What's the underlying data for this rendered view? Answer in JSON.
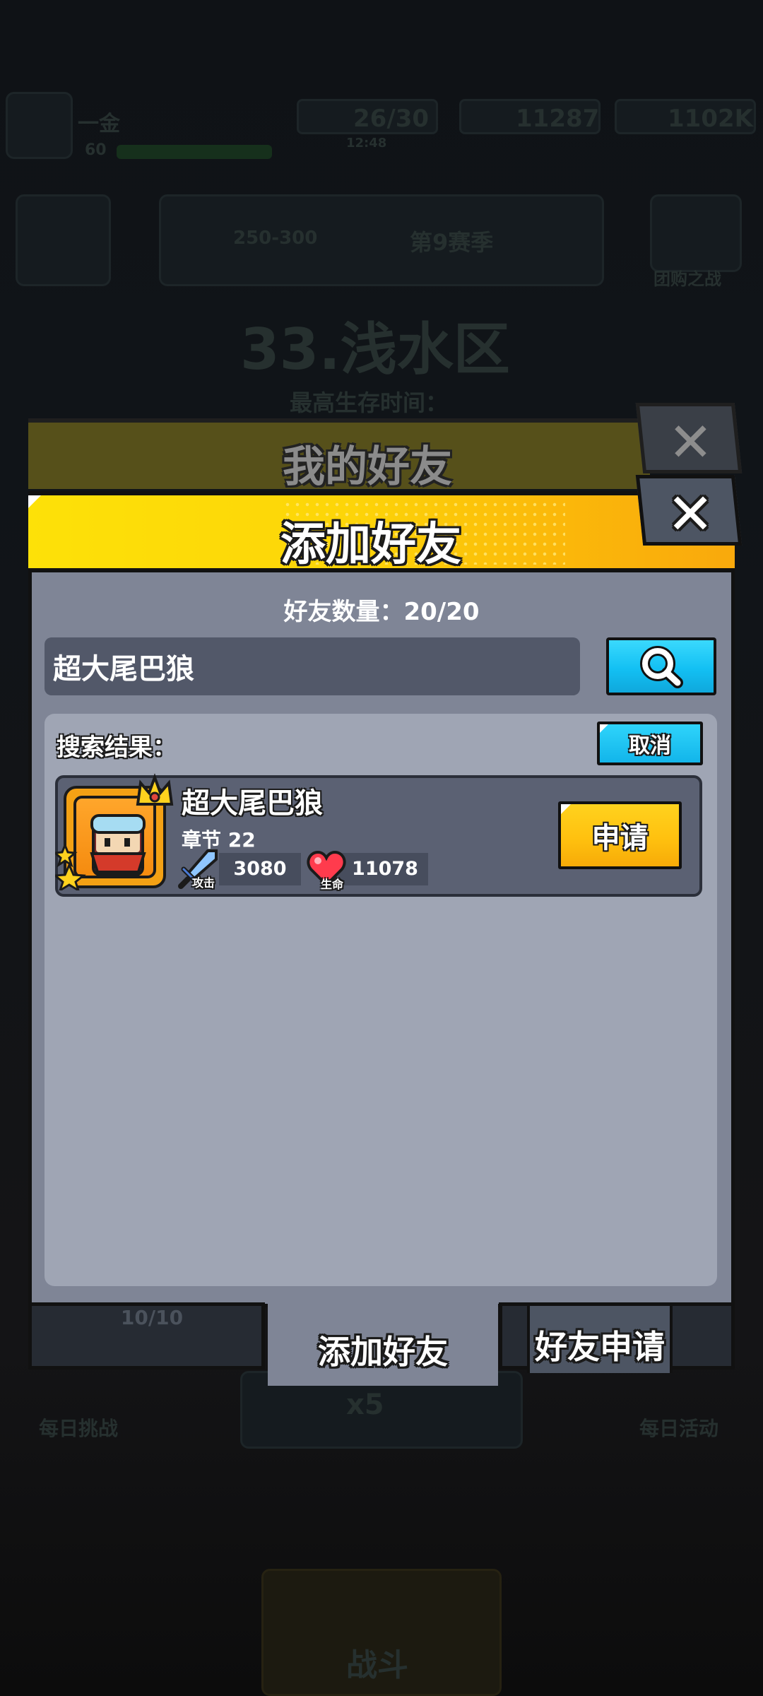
{
  "background": {
    "player_name": "一金",
    "player_level": "60",
    "energy": "26/30",
    "energy_timer": "12:48",
    "gems": "11287",
    "gold": "1102K",
    "season_range": "250-300",
    "season_label": "第9赛季",
    "right_button_label": "团购之战",
    "stage_title": "33.浅水区",
    "survival_time_label": "最高生存时间：",
    "daily_challenge": "每日挑战",
    "multiplier": "x5",
    "daily_activity": "每日活动",
    "battle": "战斗"
  },
  "back_dialog": {
    "title": "我的好友",
    "close_glyph": "✕"
  },
  "dialog": {
    "title": "添加好友",
    "close_glyph": "✕",
    "friend_count": "好友数量：20/20",
    "search": {
      "value": "超大尾巴狼",
      "button_icon": "search-icon"
    },
    "results_label": "搜索结果：",
    "cancel_label": "取消",
    "result": {
      "name": "超大尾巴狼",
      "chapter": "章节 22",
      "attack_label": "攻击",
      "attack": "3080",
      "hp_label": "生命",
      "hp": "11078",
      "apply_label": "申请"
    }
  },
  "tabs": {
    "friends_count": "10/10",
    "add_friend": "添加好友",
    "friend_requests": "好友申请"
  },
  "colors": {
    "header_yellow": "#fde108",
    "button_cyan": "#13c0f3",
    "button_yellow": "#ffc10f",
    "panel": "#7f8596"
  }
}
